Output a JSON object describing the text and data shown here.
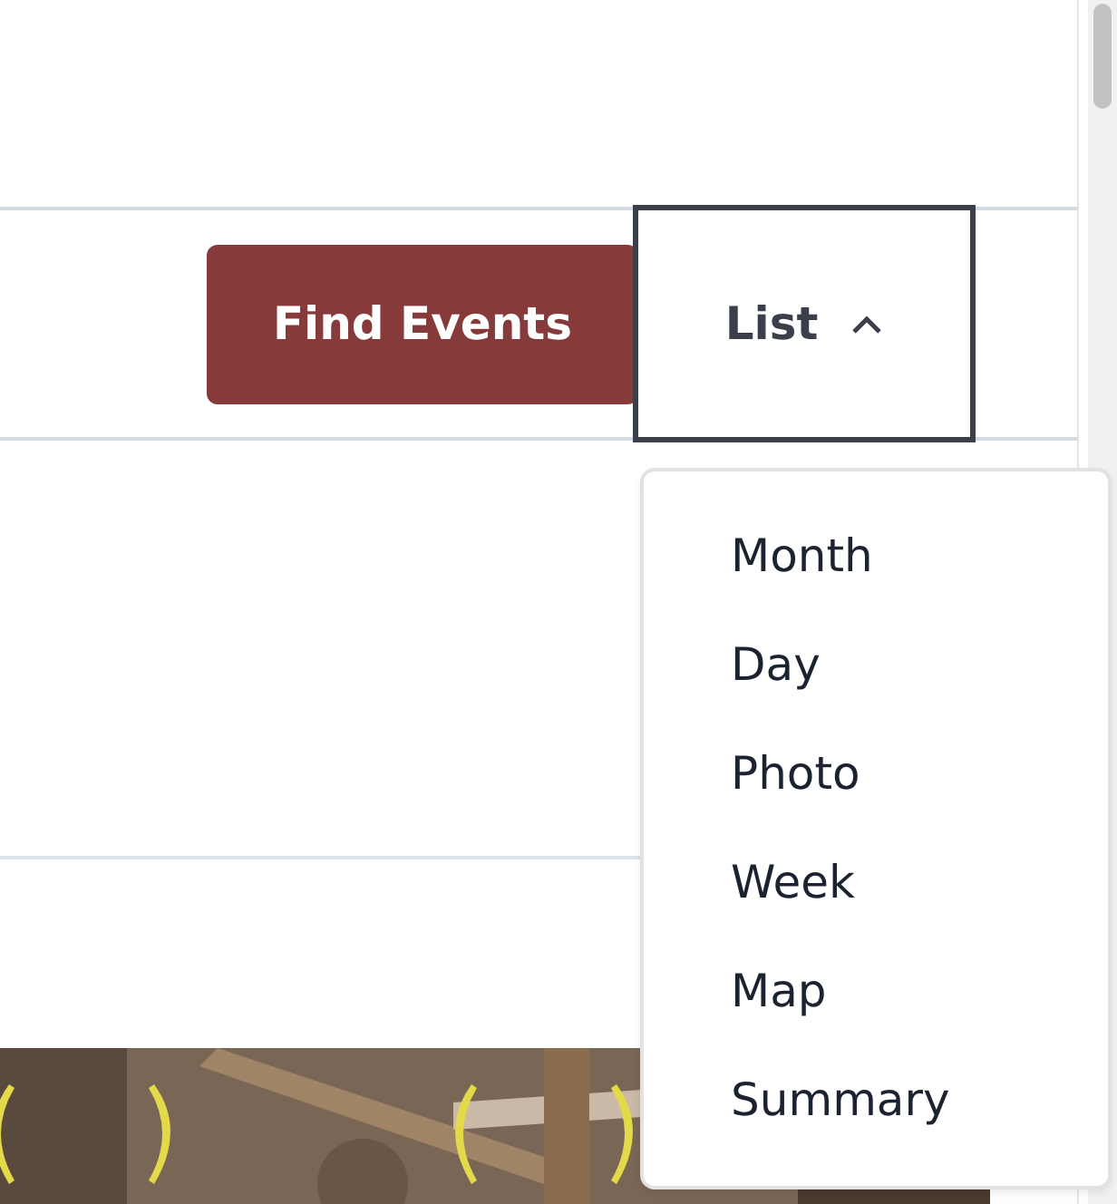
{
  "search_bar": {
    "submit_button": {
      "label": "Find Events"
    },
    "view_selector": {
      "label": "List",
      "expanded": true,
      "options": [
        {
          "label": "Month"
        },
        {
          "label": "Day"
        },
        {
          "label": "Photo"
        },
        {
          "label": "Week"
        },
        {
          "label": "Map"
        },
        {
          "label": "Summary"
        }
      ]
    }
  }
}
